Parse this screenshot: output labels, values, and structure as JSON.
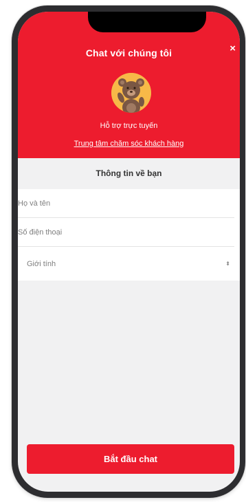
{
  "header": {
    "title": "Chat với chúng tôi",
    "close_icon": "×",
    "status": "Hỗ trợ trực tuyến",
    "care_link": "Trung tâm chăm sóc khách hàng",
    "accent_color": "#ed1c2e",
    "avatar_icon": "teddy-bear-icon"
  },
  "form": {
    "section_title": "Thông tin về bạn",
    "name_placeholder": "Họ và tên",
    "phone_placeholder": "Số điện thoại",
    "gender_value": "Giới tính",
    "gender_arrows": "⬍"
  },
  "actions": {
    "start_label": "Bắt đầu chat"
  }
}
